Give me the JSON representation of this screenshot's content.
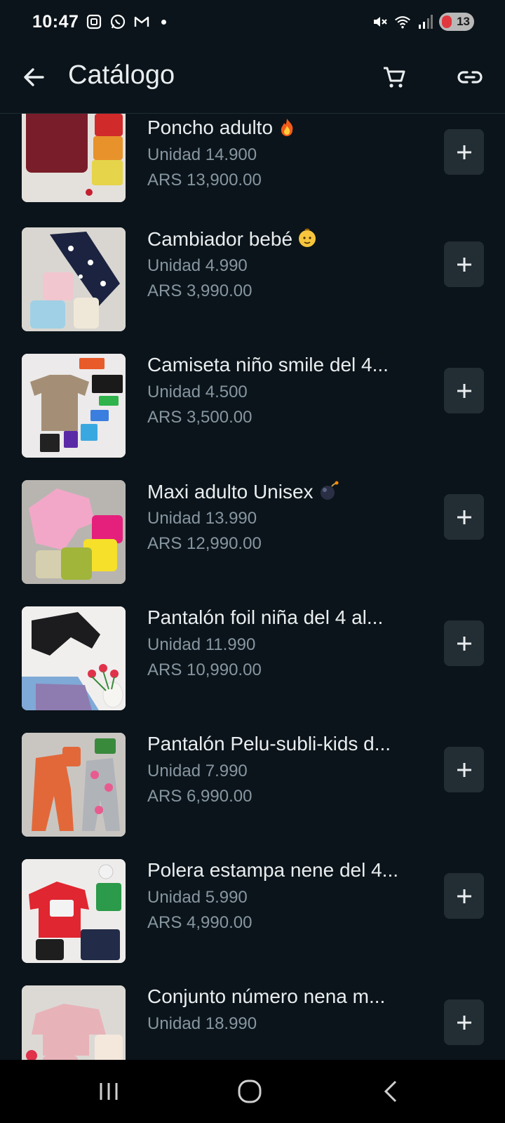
{
  "status_bar": {
    "time": "10:47",
    "battery": "13",
    "icons": [
      "screenshot-icon",
      "whatsapp-icon",
      "gmail-icon",
      "mute-icon",
      "wifi-icon",
      "signal-icon"
    ]
  },
  "header": {
    "title": "Catálogo"
  },
  "products": [
    {
      "name": "Poncho adulto",
      "emoji": "fire-emoji",
      "unit": "Unidad 14.900",
      "price": "ARS 13,900.00",
      "colors": [
        "#7a1d2a",
        "#d12a2a",
        "#e8922b",
        "#e6d44a"
      ]
    },
    {
      "name": "Cambiador bebé",
      "emoji": "baby-emoji",
      "unit": "Unidad 4.990",
      "price": "ARS 3,990.00",
      "colors": [
        "#1b2340",
        "#f1c6cf",
        "#9fd0e6",
        "#efe8d8"
      ]
    },
    {
      "name": "Camiseta niño smile del 4...",
      "emoji": "",
      "unit": "Unidad 4.500",
      "price": "ARS 3,500.00",
      "colors": [
        "#a48f76",
        "#e85a2a",
        "#1a1a1a",
        "#2fb34a"
      ]
    },
    {
      "name": "Maxi adulto Unisex",
      "emoji": "bomb-emoji",
      "unit": "Unidad 13.990",
      "price": "ARS 12,990.00",
      "colors": [
        "#f2a7c8",
        "#e4207c",
        "#f6e02a",
        "#a0b53a"
      ]
    },
    {
      "name": "Pantalón foil niña del 4 al...",
      "emoji": "",
      "unit": "Unidad 11.990",
      "price": "ARS 10,990.00",
      "colors": [
        "#1c1c1e",
        "#e0324a",
        "#7fa9d6",
        "#efe8e2"
      ]
    },
    {
      "name": "Pantalón Pelu-subli-kids d...",
      "emoji": "",
      "unit": "Unidad 7.990",
      "price": "ARS 6,990.00",
      "colors": [
        "#e2683a",
        "#b0b3b8",
        "#e85b8f",
        "#3a8a3c"
      ]
    },
    {
      "name": "Polera estampa nene del 4...",
      "emoji": "",
      "unit": "Unidad 5.990",
      "price": "ARS 4,990.00",
      "colors": [
        "#e02630",
        "#222c48",
        "#2b9a4a",
        "#1e1e1e"
      ]
    },
    {
      "name": "Conjunto número nena m...",
      "emoji": "",
      "unit": "Unidad 18.990",
      "price": "",
      "colors": [
        "#e7b3b9",
        "#f4e7dc",
        "#e0324a",
        "#c6c6c6"
      ]
    }
  ],
  "nav_bar": {
    "buttons": [
      "recents-icon",
      "home-icon",
      "back-nav-icon"
    ]
  }
}
